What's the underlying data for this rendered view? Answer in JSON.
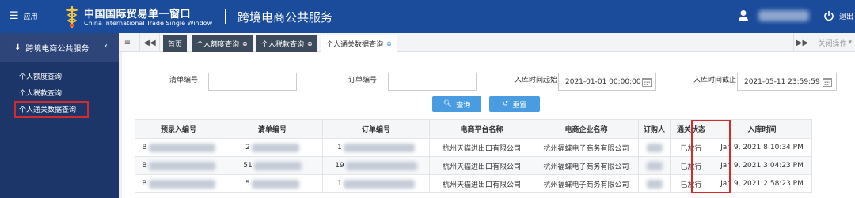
{
  "topbar": {
    "menu_label": "应用",
    "brand_cn": "中国国际贸易单一窗口",
    "brand_en": "China International Trade Single Window",
    "app_title": "跨境电商公共服务",
    "logout": "退出"
  },
  "sidebar": {
    "title": "跨境电商公共服务",
    "items": [
      {
        "label": "个人额度查询"
      },
      {
        "label": "个人税款查询"
      },
      {
        "label": "个人通关数据查询"
      }
    ]
  },
  "tabs": {
    "home": "首页",
    "quota": "个人额度查询",
    "tax": "个人税款查询",
    "customs": "个人通关数据查询",
    "close_ops": "关闭操作"
  },
  "form": {
    "manifest_label": "清单编号",
    "order_label": "订单编号",
    "start_label": "入库时间起始",
    "start_value": "2021-01-01 00:00:00",
    "end_label": "入库时间截止",
    "end_value": "2021-05-11 23:59:59",
    "query_label": "查询",
    "reset_label": "重置"
  },
  "table": {
    "headers": [
      "预录入编号",
      "清单编号",
      "订单编号",
      "电商平台名称",
      "电商企业名称",
      "订购人",
      "通关状态",
      "入库时间"
    ],
    "rows": [
      {
        "pre": "B",
        "manifest": "2",
        "order": "1",
        "platform": "杭州天猫进出口有限公司",
        "enterprise": "杭州福蝶电子商务有限公司",
        "status": "已放行",
        "time": "Jan 9, 2021 8:10:34 PM"
      },
      {
        "pre": "B",
        "manifest": "51",
        "order": "19",
        "platform": "杭州天猫进出口有限公司",
        "enterprise": "杭州福蝶电子商务有限公司",
        "status": "已放行",
        "time": "Jan 9, 2021 3:04:23 PM"
      },
      {
        "pre": "B",
        "manifest": "5",
        "order": "1",
        "platform": "杭州天猫进出口有限公司",
        "enterprise": "杭州福蝶电子商务有限公司",
        "status": "已放行",
        "time": "Jan 9, 2021 2:58:23 PM"
      }
    ]
  },
  "colors": {
    "topbar": "#1a4c9b",
    "sidebar": "#1c3669",
    "button": "#4a9ce0",
    "highlight": "#d42a2a"
  }
}
